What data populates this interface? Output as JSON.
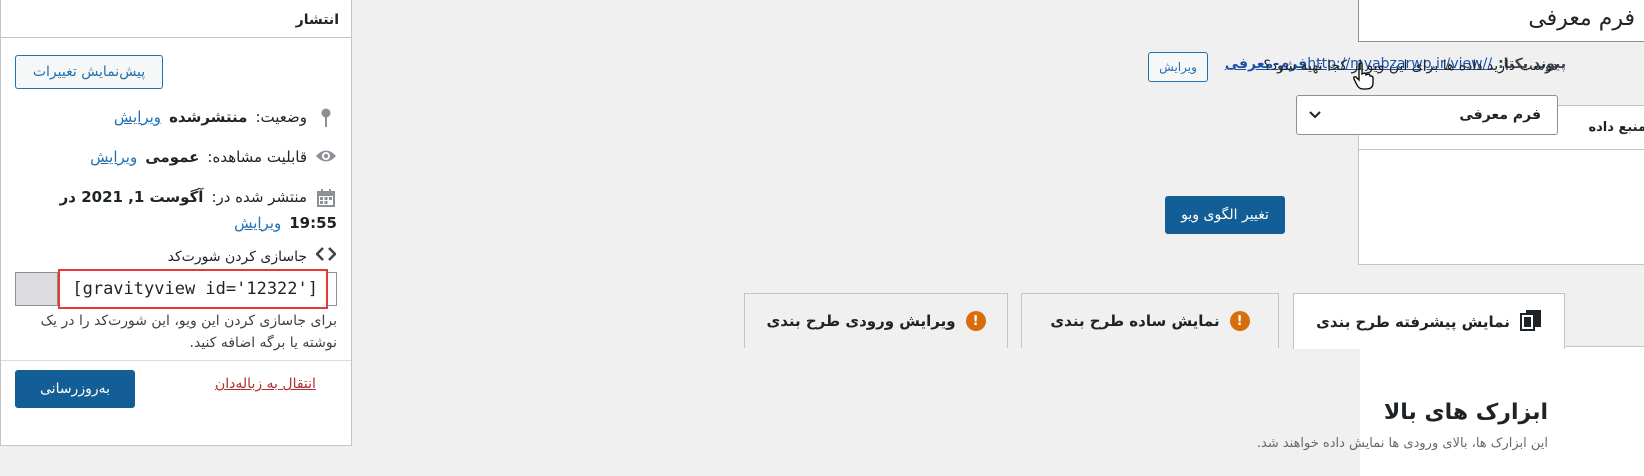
{
  "publish": {
    "heading": "انتشار",
    "preview_button": "پیش‌نمایش تغییرات",
    "status_label": "وضعیت:",
    "status_value": "منتشرشده",
    "visibility_label": "قابلیت مشاهده:",
    "visibility_value": "عمومی",
    "published_label": "منتشر شده در:",
    "published_value_line1": "آگوست 1, 2021 در",
    "published_value_line2": "19:55",
    "edit_link": "ویرایش",
    "shortcode_label": "جاسازی کردن شورت‌کد",
    "shortcode_value": "[gravityview id='12322']",
    "shortcode_help": "برای جاسازی کردن این ویو، این شورت‌کد را در یک نوشته یا برگه اضافه کنید.",
    "trash_link": "انتقال به زباله‌دان",
    "update_button": "به‌روزرسانی"
  },
  "title": {
    "value": "فرم معرفی"
  },
  "permalink": {
    "label": "پیوند یکتا:",
    "url_base": "http://myabzarwp.ir/view/",
    "url_slug": "فرم-معرفی",
    "url_tail": "/",
    "edit_button": "ویرایش"
  },
  "datasource": {
    "heading": "منبع داده",
    "question": "دوست دارید داده ها برای این ویو از کجا تهیه شود؟",
    "selected_form": "فرم معرفی",
    "change_button": "تغییر الگوی ویو"
  },
  "tabs": [
    {
      "label": "نمایش پیشرفته طرح بندی",
      "icon": "copy-icon"
    },
    {
      "label": "نمایش ساده طرح بندی",
      "icon": "warning-icon"
    },
    {
      "label": "ویرایش ورودی طرح بندی",
      "icon": "warning-icon"
    }
  ],
  "content": {
    "section_title": "ابزارک های بالا",
    "section_sub": "این ابزارک ها، بالای ورودی ها نمایش داده خواهند شد."
  },
  "colors": {
    "primary": "#135e96",
    "link": "#2271b1",
    "warning": "#d86e0b",
    "highlight": "#e53935"
  }
}
